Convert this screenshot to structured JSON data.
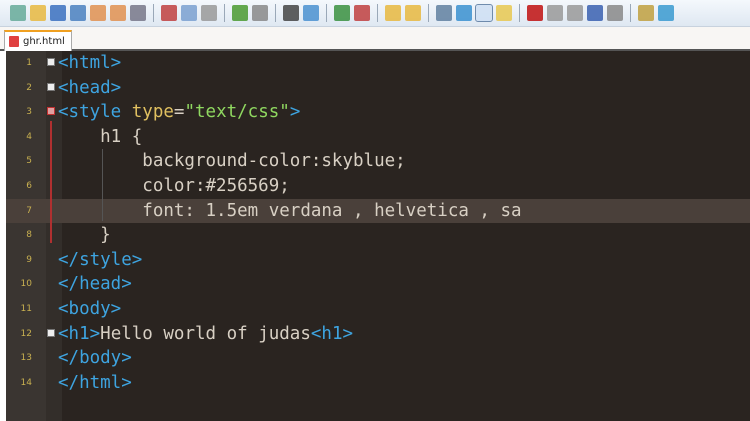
{
  "toolbar": {
    "icons": [
      "new-file",
      "open-file",
      "save",
      "save-all",
      "close",
      "close-all",
      "print",
      "cut",
      "copy",
      "paste",
      "undo",
      "redo",
      "find",
      "replace",
      "zoom-in",
      "zoom-out",
      "sync-vertical",
      "sync-horizontal",
      "word-wrap",
      "show-all-chars",
      "indent-guide",
      "doc-map",
      "record-macro",
      "stop-macro",
      "play-macro",
      "run-macro-multiple",
      "save-macro",
      "launch-browser",
      "spell-check"
    ]
  },
  "tab": {
    "label": "ghr.html"
  },
  "lines": [
    {
      "n": "1",
      "parts": [
        [
          "t",
          "<html>"
        ]
      ]
    },
    {
      "n": "2",
      "parts": [
        [
          "t",
          "<head>"
        ]
      ]
    },
    {
      "n": "3",
      "parts": [
        [
          "t",
          "<style "
        ],
        [
          "a",
          "type"
        ],
        [
          "p",
          "="
        ],
        [
          "s",
          "\"text/css\""
        ],
        [
          "t",
          ">"
        ]
      ]
    },
    {
      "n": "4",
      "parts": [
        [
          "p",
          "    h1 {"
        ]
      ]
    },
    {
      "n": "5",
      "parts": [
        [
          "p",
          "        background-color:skyblue;"
        ]
      ]
    },
    {
      "n": "6",
      "parts": [
        [
          "p",
          "        color:#256569;"
        ]
      ]
    },
    {
      "n": "7",
      "parts": [
        [
          "p",
          "        font: 1.5em verdana , helvetica , sa"
        ]
      ]
    },
    {
      "n": "8",
      "parts": [
        [
          "p",
          "    }"
        ]
      ]
    },
    {
      "n": "9",
      "parts": [
        [
          "t",
          "</style>"
        ]
      ]
    },
    {
      "n": "10",
      "parts": [
        [
          "t",
          "</head>"
        ]
      ]
    },
    {
      "n": "11",
      "parts": [
        [
          "t",
          "<body>"
        ]
      ]
    },
    {
      "n": "12",
      "parts": [
        [
          "t",
          "<h1>"
        ],
        [
          "p",
          "Hello world of judas"
        ],
        [
          "t",
          "<h1>"
        ]
      ]
    },
    {
      "n": "13",
      "parts": [
        [
          "t",
          "</body>"
        ]
      ]
    },
    {
      "n": "14",
      "parts": [
        [
          "t",
          "</html>"
        ]
      ]
    }
  ]
}
